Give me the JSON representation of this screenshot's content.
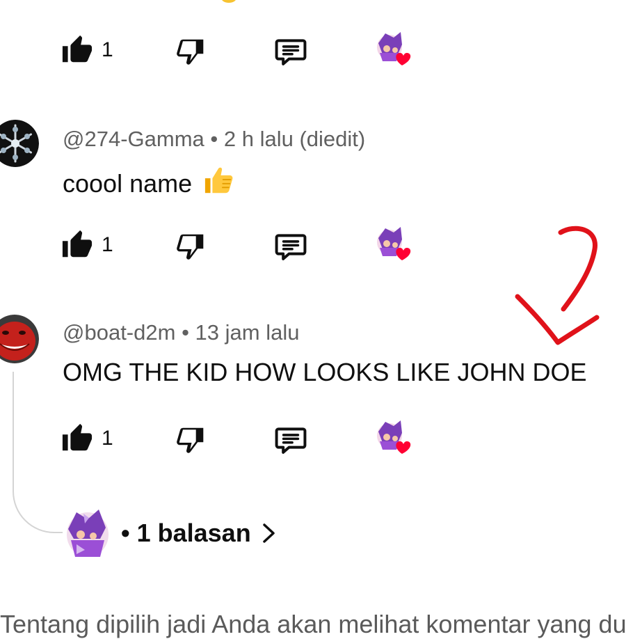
{
  "colors": {
    "text_primary": "#0f0f0f",
    "text_secondary": "#606060",
    "heart_red": "#ff0033",
    "annotation_red": "#e0121a",
    "thread_line": "#d4d4d4"
  },
  "icons": {
    "like": "thumbs-up-filled-icon",
    "dislike": "thumbs-down-outline-icon",
    "reply": "comment-icon",
    "creator_heart": "creator-heart-icon",
    "chevron": "chevron-right-icon",
    "annotation": "hand-drawn-arrow"
  },
  "previous_comment": {
    "likes": "1"
  },
  "comments": [
    {
      "handle": "@274-Gamma",
      "sep": "•",
      "time": "2 h lalu (diedit)",
      "text": "coool name",
      "emoji": "👍",
      "likes": "1",
      "hearted": true
    },
    {
      "handle": "@boat-d2m",
      "sep": "•",
      "time": "13 jam lalu",
      "text": "OMG THE KID HOW LOOKS LIKE JOHN DOE",
      "likes": "1",
      "hearted": true,
      "replies_label": "• 1 balasan"
    }
  ],
  "footer_text": "Tentang dipilih jadi Anda akan melihat komentar yang dua"
}
